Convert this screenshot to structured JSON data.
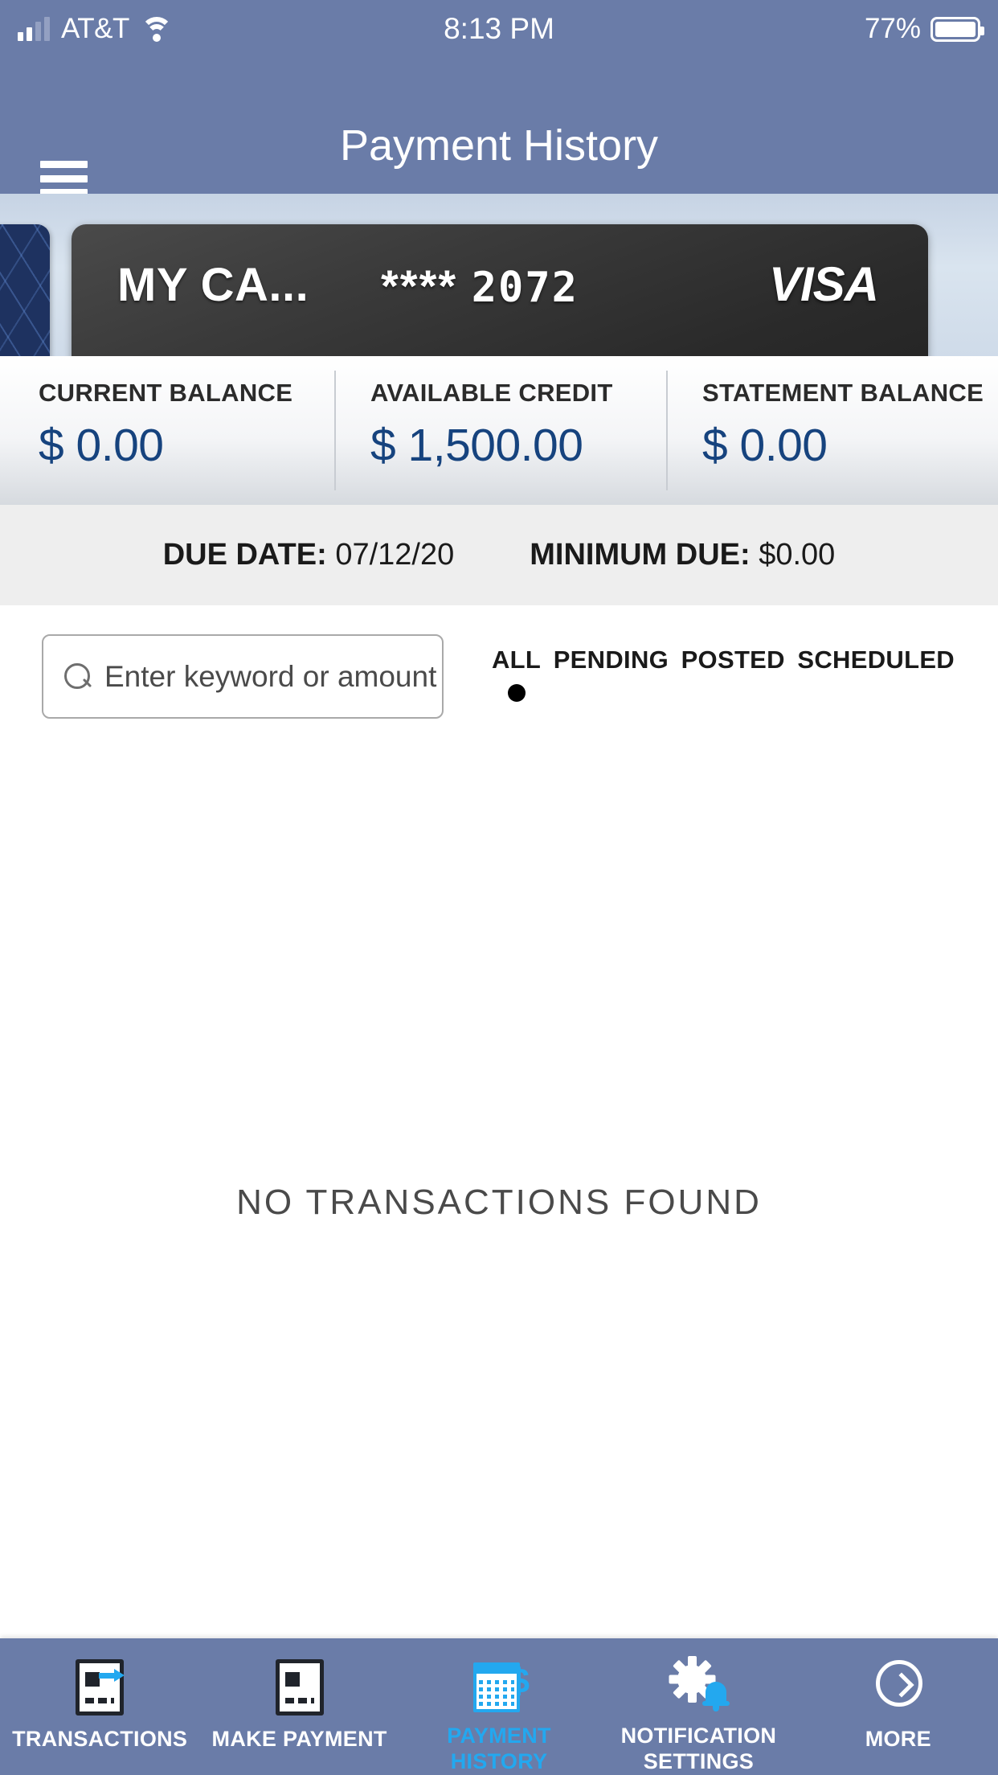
{
  "status_bar": {
    "carrier": "AT&T",
    "time": "8:13 PM",
    "battery_percent": "77%",
    "signal_icon": "cellular-signal-icon",
    "wifi_icon": "wifi-icon",
    "battery_icon": "battery-icon"
  },
  "header": {
    "title": "Payment History",
    "menu_icon": "hamburger-menu-icon",
    "background_color": "#6a7ca8"
  },
  "card": {
    "name": "MY CA...",
    "mask": "****",
    "last_four": "2072",
    "brand": "VISA",
    "has_previous_card": true
  },
  "balances": [
    {
      "label": "CURRENT BALANCE",
      "value": "$ 0.00"
    },
    {
      "label": "AVAILABLE CREDIT",
      "value": "$ 1,500.00"
    },
    {
      "label": "STATEMENT BALANCE",
      "value": "$ 0.00"
    }
  ],
  "due_row": {
    "due_date_label": "DUE DATE:",
    "due_date_value": "07/12/20",
    "minimum_due_label": "MINIMUM DUE:",
    "minimum_due_value": "$0.00"
  },
  "search": {
    "placeholder": "Enter keyword or amount",
    "value": "",
    "icon": "search-icon"
  },
  "filters": [
    {
      "label": "ALL",
      "selected": true
    },
    {
      "label": "PENDING",
      "selected": false
    },
    {
      "label": "POSTED",
      "selected": false
    },
    {
      "label": "SCHEDULED",
      "selected": false
    }
  ],
  "content": {
    "empty_message": "NO TRANSACTIONS FOUND"
  },
  "tabbar": {
    "active_color": "#23a8ef",
    "background_color": "#6a7ca8",
    "items": [
      {
        "label": "TRANSACTIONS",
        "icon": "card-arrow-icon",
        "active": false
      },
      {
        "label": "MAKE PAYMENT",
        "icon": "card-icon",
        "active": false
      },
      {
        "label": "PAYMENT\nHISTORY",
        "icon": "ledger-grid-icon",
        "active": true
      },
      {
        "label": "NOTIFICATION\nSETTINGS",
        "icon": "gear-bell-icon",
        "active": false
      },
      {
        "label": "MORE",
        "icon": "chevron-circle-icon",
        "active": false
      }
    ]
  }
}
